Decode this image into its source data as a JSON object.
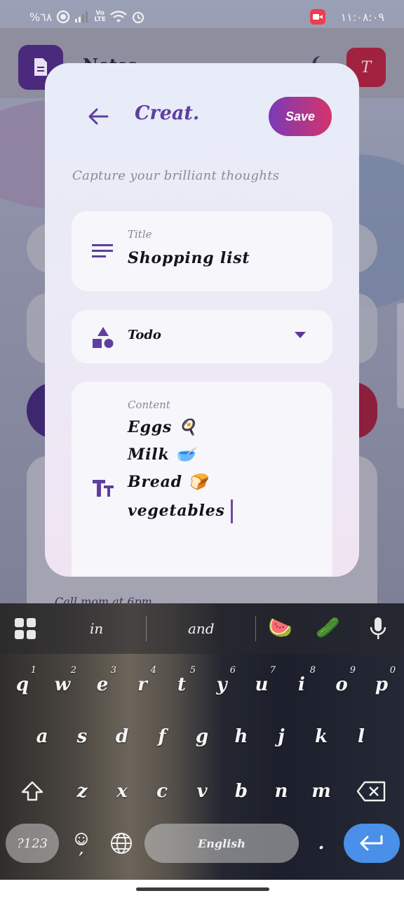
{
  "status_bar": {
    "time": "١١:٠٨:٠٩",
    "battery": "%٦٨"
  },
  "background_app": {
    "title": "Notes",
    "avatar_initial": "T",
    "peek_text": "Call mom at 6pm"
  },
  "dialog": {
    "title": "Creat.",
    "save_label": "Save",
    "subtitle": "Capture your brilliant thoughts",
    "title_field": {
      "label": "Title",
      "value": "Shopping list"
    },
    "type_field": {
      "value": "Todo"
    },
    "content_field": {
      "label": "Content",
      "lines": [
        "Eggs 🍳",
        "Milk 🥣",
        "Bread 🍞",
        "vegetables"
      ]
    }
  },
  "keyboard": {
    "suggestions": [
      "in",
      "and"
    ],
    "suggestion_emojis": [
      "🍉",
      "🥒"
    ],
    "row1": [
      "q",
      "w",
      "e",
      "r",
      "t",
      "y",
      "u",
      "i",
      "o",
      "p"
    ],
    "row1_hints": [
      "1",
      "2",
      "3",
      "4",
      "5",
      "6",
      "7",
      "8",
      "9",
      "0"
    ],
    "row2": [
      "a",
      "s",
      "d",
      "f",
      "g",
      "h",
      "j",
      "k",
      "l"
    ],
    "row3": [
      "z",
      "x",
      "c",
      "v",
      "b",
      "n",
      "m"
    ],
    "symbols_label": "?123",
    "comma_label": ",",
    "space_label": "English",
    "period_label": ".",
    "accent_color": "#4a90e8"
  },
  "colors": {
    "primary": "#5e3f9e",
    "save_gradient_start": "#7a3ab8",
    "save_gradient_end": "#d5346a"
  }
}
